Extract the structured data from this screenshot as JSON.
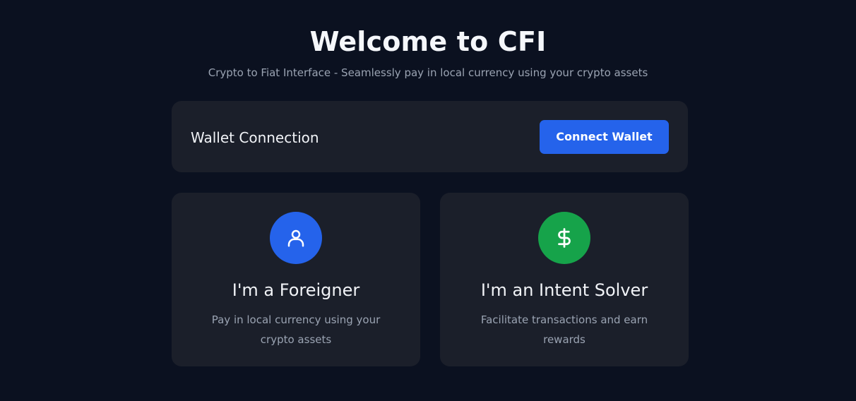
{
  "header": {
    "title": "Welcome to CFI",
    "subtitle": "Crypto to Fiat Interface - Seamlessly pay in local currency using your crypto assets"
  },
  "wallet": {
    "label": "Wallet Connection",
    "button_label": "Connect Wallet"
  },
  "roles": [
    {
      "title": "I'm a Foreigner",
      "description": "Pay in local currency using your crypto assets",
      "icon": "user-icon",
      "icon_color": "#2563eb"
    },
    {
      "title": "I'm an Intent Solver",
      "description": "Facilitate transactions and earn rewards",
      "icon": "dollar-icon",
      "icon_color": "#16a34a"
    }
  ],
  "colors": {
    "background": "#0b1120",
    "card": "#1b1f2a",
    "primary": "#2563eb",
    "success": "#16a34a"
  }
}
